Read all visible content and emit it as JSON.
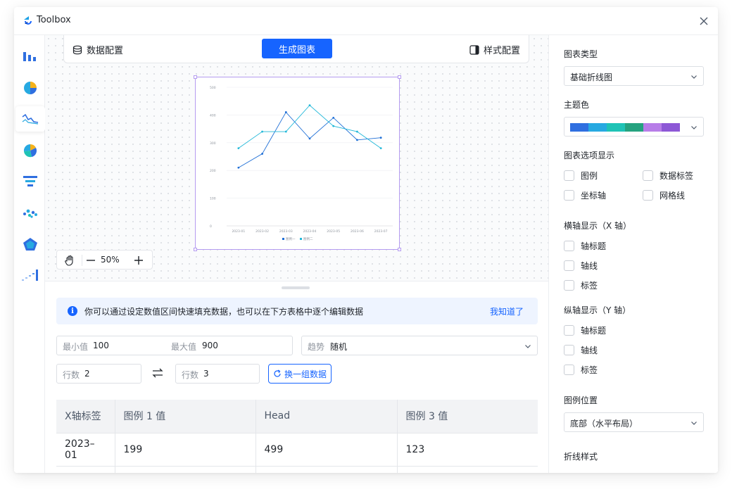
{
  "app": {
    "title": "Toolbox"
  },
  "toolbar": {
    "data_config": "数据配置",
    "generate": "生成图表",
    "style_config": "样式配置"
  },
  "rail": {
    "items": [
      "bar-chart-icon",
      "pie-chart-icon",
      "line-chart-icon",
      "donut-chart-icon",
      "funnel-chart-icon",
      "scatter-chart-icon",
      "radar-chart-icon",
      "step-chart-icon"
    ],
    "active_index": 2
  },
  "zoom": {
    "value": "50%"
  },
  "chart_data": {
    "type": "line",
    "categories": [
      "2023-01",
      "2023-02",
      "2023-03",
      "2023-04",
      "2023-05",
      "2023-06",
      "2023-07"
    ],
    "series": [
      {
        "name": "图例一",
        "values": [
          210,
          260,
          410,
          315,
          390,
          310,
          318
        ],
        "color": "#1f6fd6"
      },
      {
        "name": "图例二",
        "values": [
          280,
          340,
          340,
          435,
          360,
          340,
          280
        ],
        "color": "#22b8d9"
      }
    ],
    "yticks": [
      0,
      100,
      200,
      300,
      400,
      500
    ],
    "ylim": [
      0,
      500
    ],
    "legend": "bottom"
  },
  "info": {
    "text": "你可以通过设定数值区间快速填充数据，也可以在下方表格中逐个编辑数据",
    "link": "我知道了"
  },
  "form": {
    "min_label": "最小值",
    "min_value": "100",
    "max_label": "最大值",
    "max_value": "900",
    "trend_label": "趋势",
    "trend_value": "随机",
    "rows_label": "行数",
    "rows_value": "2",
    "cols_label": "行数",
    "cols_value": "3",
    "refresh": "换一组数据"
  },
  "table": {
    "headers": [
      "X轴标签",
      "图例 1 值",
      "Head",
      "图例 3 值"
    ],
    "rows": [
      [
        "2023–01",
        "199",
        "499",
        "123"
      ],
      [
        "",
        "",
        "",
        ""
      ]
    ]
  },
  "panel": {
    "chart_type_title": "图表类型",
    "chart_type_value": "基础折线图",
    "theme_title": "主题色",
    "theme_colors": [
      "#2f6fe0",
      "#27a9e1",
      "#1fc3b6",
      "#25a27f",
      "#b77de8",
      "#8d58d6"
    ],
    "options_title": "图表选项显示",
    "options": [
      "图例",
      "数据标签",
      "坐标轴",
      "网格线"
    ],
    "xaxis_title": "横轴显示（X 轴）",
    "xaxis_options": [
      "轴标题",
      "轴线",
      "标签"
    ],
    "yaxis_title": "纵轴显示（Y 轴）",
    "yaxis_options": [
      "轴标题",
      "轴线",
      "标签"
    ],
    "legend_pos_title": "图例位置",
    "legend_pos_value": "底部（水平布局）",
    "line_style_title": "折线样式"
  }
}
